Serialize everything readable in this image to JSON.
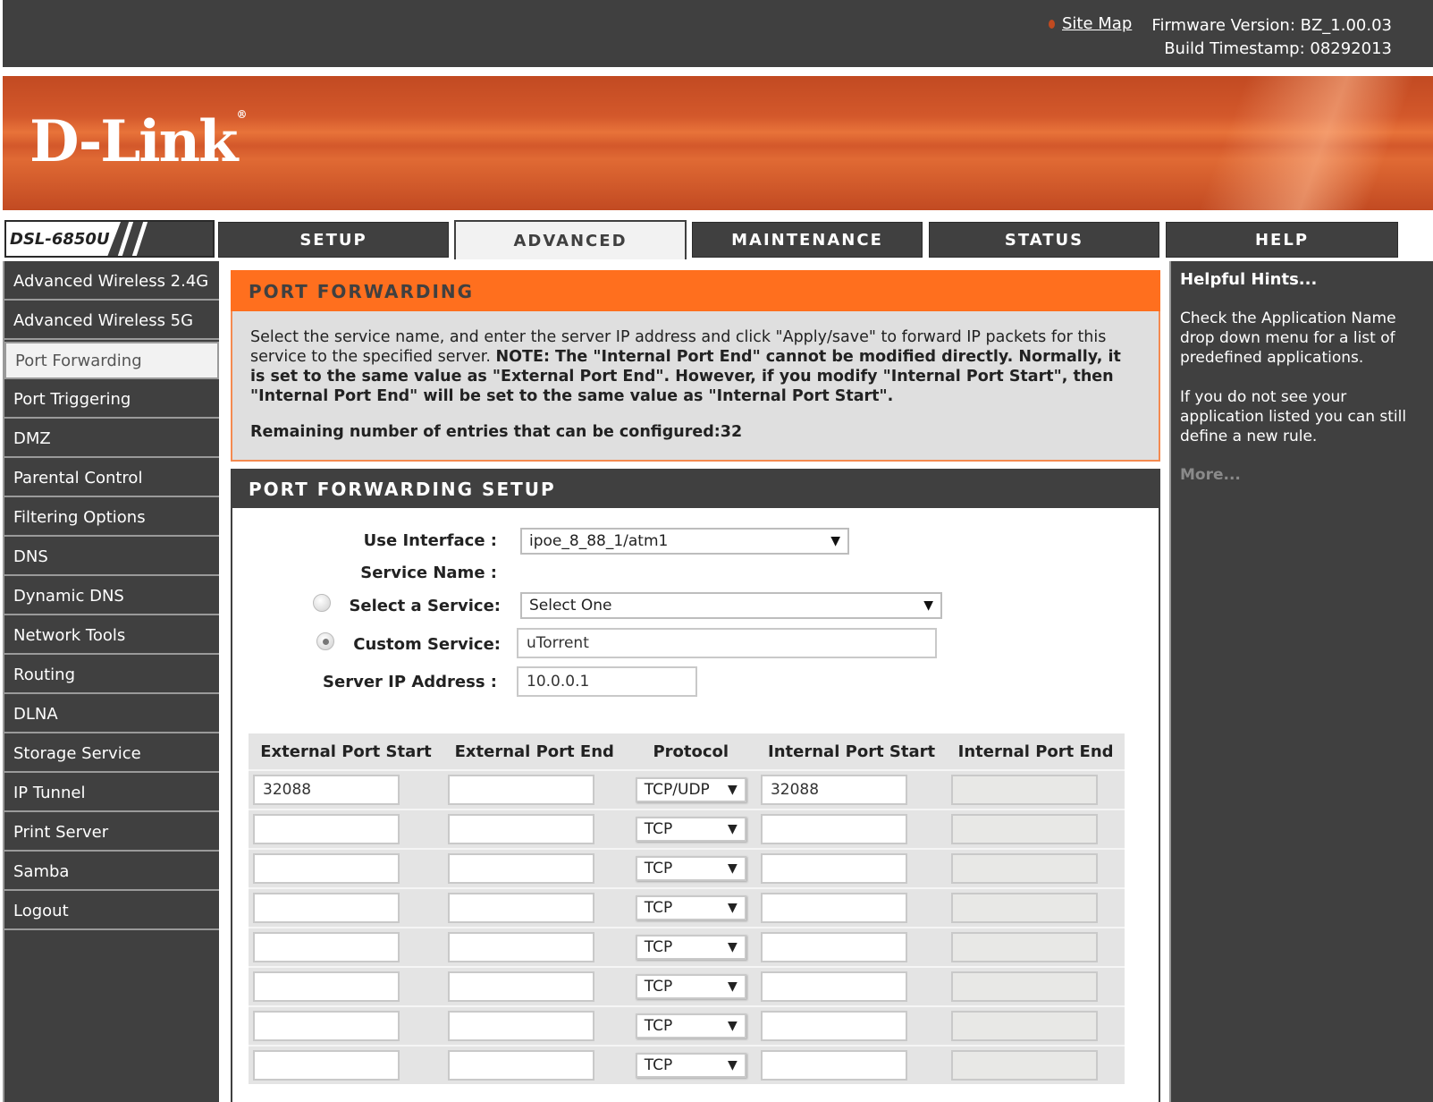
{
  "header": {
    "site_map": "Site Map",
    "firmware": "Firmware Version: BZ_1.00.03",
    "build": "Build Timestamp: 08292013",
    "logo": "D-Link",
    "logo_mark": "®",
    "model": "DSL-6850U"
  },
  "tabs": [
    {
      "label": "SETUP",
      "active": false
    },
    {
      "label": "ADVANCED",
      "active": true
    },
    {
      "label": "MAINTENANCE",
      "active": false
    },
    {
      "label": "STATUS",
      "active": false
    },
    {
      "label": "HELP",
      "active": false
    }
  ],
  "sidebar": {
    "items": [
      {
        "label": "Advanced Wireless 2.4G"
      },
      {
        "label": "Advanced Wireless 5G"
      },
      {
        "label": "Port Forwarding",
        "active": true
      },
      {
        "label": "Port Triggering"
      },
      {
        "label": "DMZ"
      },
      {
        "label": "Parental Control"
      },
      {
        "label": "Filtering Options"
      },
      {
        "label": "DNS"
      },
      {
        "label": "Dynamic DNS"
      },
      {
        "label": "Network Tools"
      },
      {
        "label": "Routing"
      },
      {
        "label": "DLNA"
      },
      {
        "label": "Storage Service"
      },
      {
        "label": "IP Tunnel"
      },
      {
        "label": "Print Server"
      },
      {
        "label": "Samba"
      },
      {
        "label": "Logout"
      }
    ]
  },
  "port_forwarding": {
    "title": "PORT FORWARDING",
    "intro": "Select the service name, and enter the server IP address and click \"Apply/save\" to forward IP packets for this service to the specified server.",
    "note": "NOTE: The \"Internal Port End\" cannot be modified directly. Normally, it is set to the same value as \"External Port End\". However, if you modify \"Internal Port Start\", then \"Internal Port End\" will be set to the same value as \"Internal Port Start\".",
    "remaining": "Remaining number of entries that can be configured:32"
  },
  "setup": {
    "title": "PORT FORWARDING SETUP",
    "use_interface_label": "Use Interface :",
    "use_interface_value": "ipoe_8_88_1/atm1",
    "service_name_label": "Service Name :",
    "select_service_label": "Select a Service:",
    "select_service_value": "Select One",
    "custom_service_label": "Custom Service:",
    "custom_service_value": "uTorrent",
    "server_ip_label": "Server IP Address :",
    "server_ip_value": "10.0.0.1",
    "selected_radio": "custom"
  },
  "table": {
    "headers": [
      "External Port Start",
      "External Port End",
      "Protocol",
      "Internal Port Start",
      "Internal Port End"
    ],
    "rows": [
      {
        "ext_start": "32088",
        "ext_end": "",
        "protocol": "TCP/UDP",
        "int_start": "32088",
        "int_end": ""
      },
      {
        "ext_start": "",
        "ext_end": "",
        "protocol": "TCP",
        "int_start": "",
        "int_end": ""
      },
      {
        "ext_start": "",
        "ext_end": "",
        "protocol": "TCP",
        "int_start": "",
        "int_end": ""
      },
      {
        "ext_start": "",
        "ext_end": "",
        "protocol": "TCP",
        "int_start": "",
        "int_end": ""
      },
      {
        "ext_start": "",
        "ext_end": "",
        "protocol": "TCP",
        "int_start": "",
        "int_end": ""
      },
      {
        "ext_start": "",
        "ext_end": "",
        "protocol": "TCP",
        "int_start": "",
        "int_end": ""
      },
      {
        "ext_start": "",
        "ext_end": "",
        "protocol": "TCP",
        "int_start": "",
        "int_end": ""
      },
      {
        "ext_start": "",
        "ext_end": "",
        "protocol": "TCP",
        "int_start": "",
        "int_end": ""
      }
    ]
  },
  "hints": {
    "title": "Helpful Hints...",
    "p1": "Check the Application Name drop down menu for a list of predefined applications.",
    "p2": "If you do not see your application listed you can still define a new rule.",
    "more": "More..."
  },
  "icons": {
    "dropdown_arrow": "▼"
  }
}
